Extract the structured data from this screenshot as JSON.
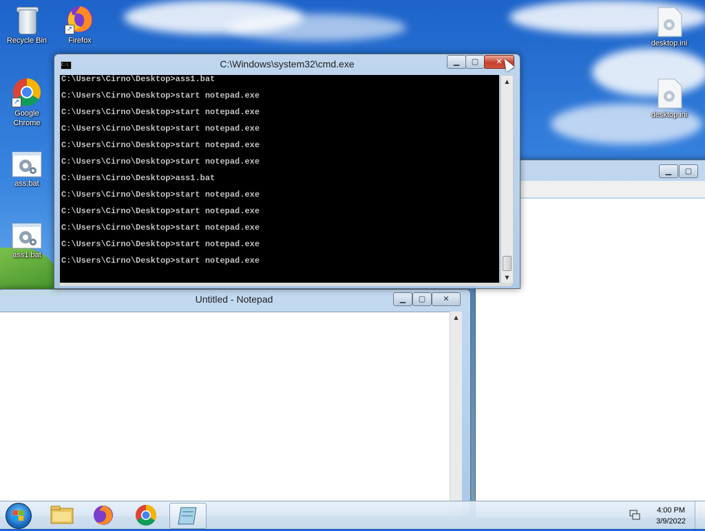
{
  "desktop": {
    "icons_left": [
      {
        "label": "Recycle Bin",
        "icon": "recycle-bin-icon"
      },
      {
        "label": "Firefox",
        "icon": "firefox-icon"
      },
      {
        "label": "Google Chrome",
        "icon": "chrome-icon"
      },
      {
        "label": "ass.bat",
        "icon": "batch-file-icon"
      },
      {
        "label": "ass1.bat",
        "icon": "batch-file-icon"
      }
    ],
    "icons_right": [
      {
        "label": "desktop.ini",
        "icon": "settings-file-icon"
      },
      {
        "label": "desktop.ini",
        "icon": "settings-file-icon"
      }
    ]
  },
  "cmd": {
    "title": "C:\\Windows\\system32\\cmd.exe",
    "icon_text": "C:\\",
    "lines": [
      "C:\\Users\\Cirno\\Desktop>ass1.bat",
      "C:\\Users\\Cirno\\Desktop>start notepad.exe",
      "C:\\Users\\Cirno\\Desktop>start notepad.exe",
      "C:\\Users\\Cirno\\Desktop>start notepad.exe",
      "C:\\Users\\Cirno\\Desktop>start notepad.exe",
      "C:\\Users\\Cirno\\Desktop>start notepad.exe",
      "C:\\Users\\Cirno\\Desktop>ass1.bat",
      "C:\\Users\\Cirno\\Desktop>start notepad.exe",
      "C:\\Users\\Cirno\\Desktop>start notepad.exe",
      "C:\\Users\\Cirno\\Desktop>start notepad.exe",
      "C:\\Users\\Cirno\\Desktop>start notepad.exe",
      "C:\\Users\\Cirno\\Desktop>start notepad.exe"
    ]
  },
  "notepad": {
    "title": "Untitled - Notepad",
    "content": ""
  },
  "window_controls": {
    "minimize": "▁",
    "maximize": "▢",
    "close": "✕"
  },
  "taskbar": {
    "pinned": [
      {
        "name": "explorer",
        "icon": "folder-icon"
      },
      {
        "name": "firefox",
        "icon": "firefox-icon"
      },
      {
        "name": "chrome",
        "icon": "chrome-icon"
      },
      {
        "name": "notepad",
        "icon": "notepad-icon",
        "active": true
      }
    ],
    "clock": {
      "time": "4:00 PM",
      "date": "3/9/2022"
    }
  },
  "colors": {
    "console_bg": "#000000",
    "console_fg": "#c0c0c0",
    "close_button": "#c5412c"
  }
}
